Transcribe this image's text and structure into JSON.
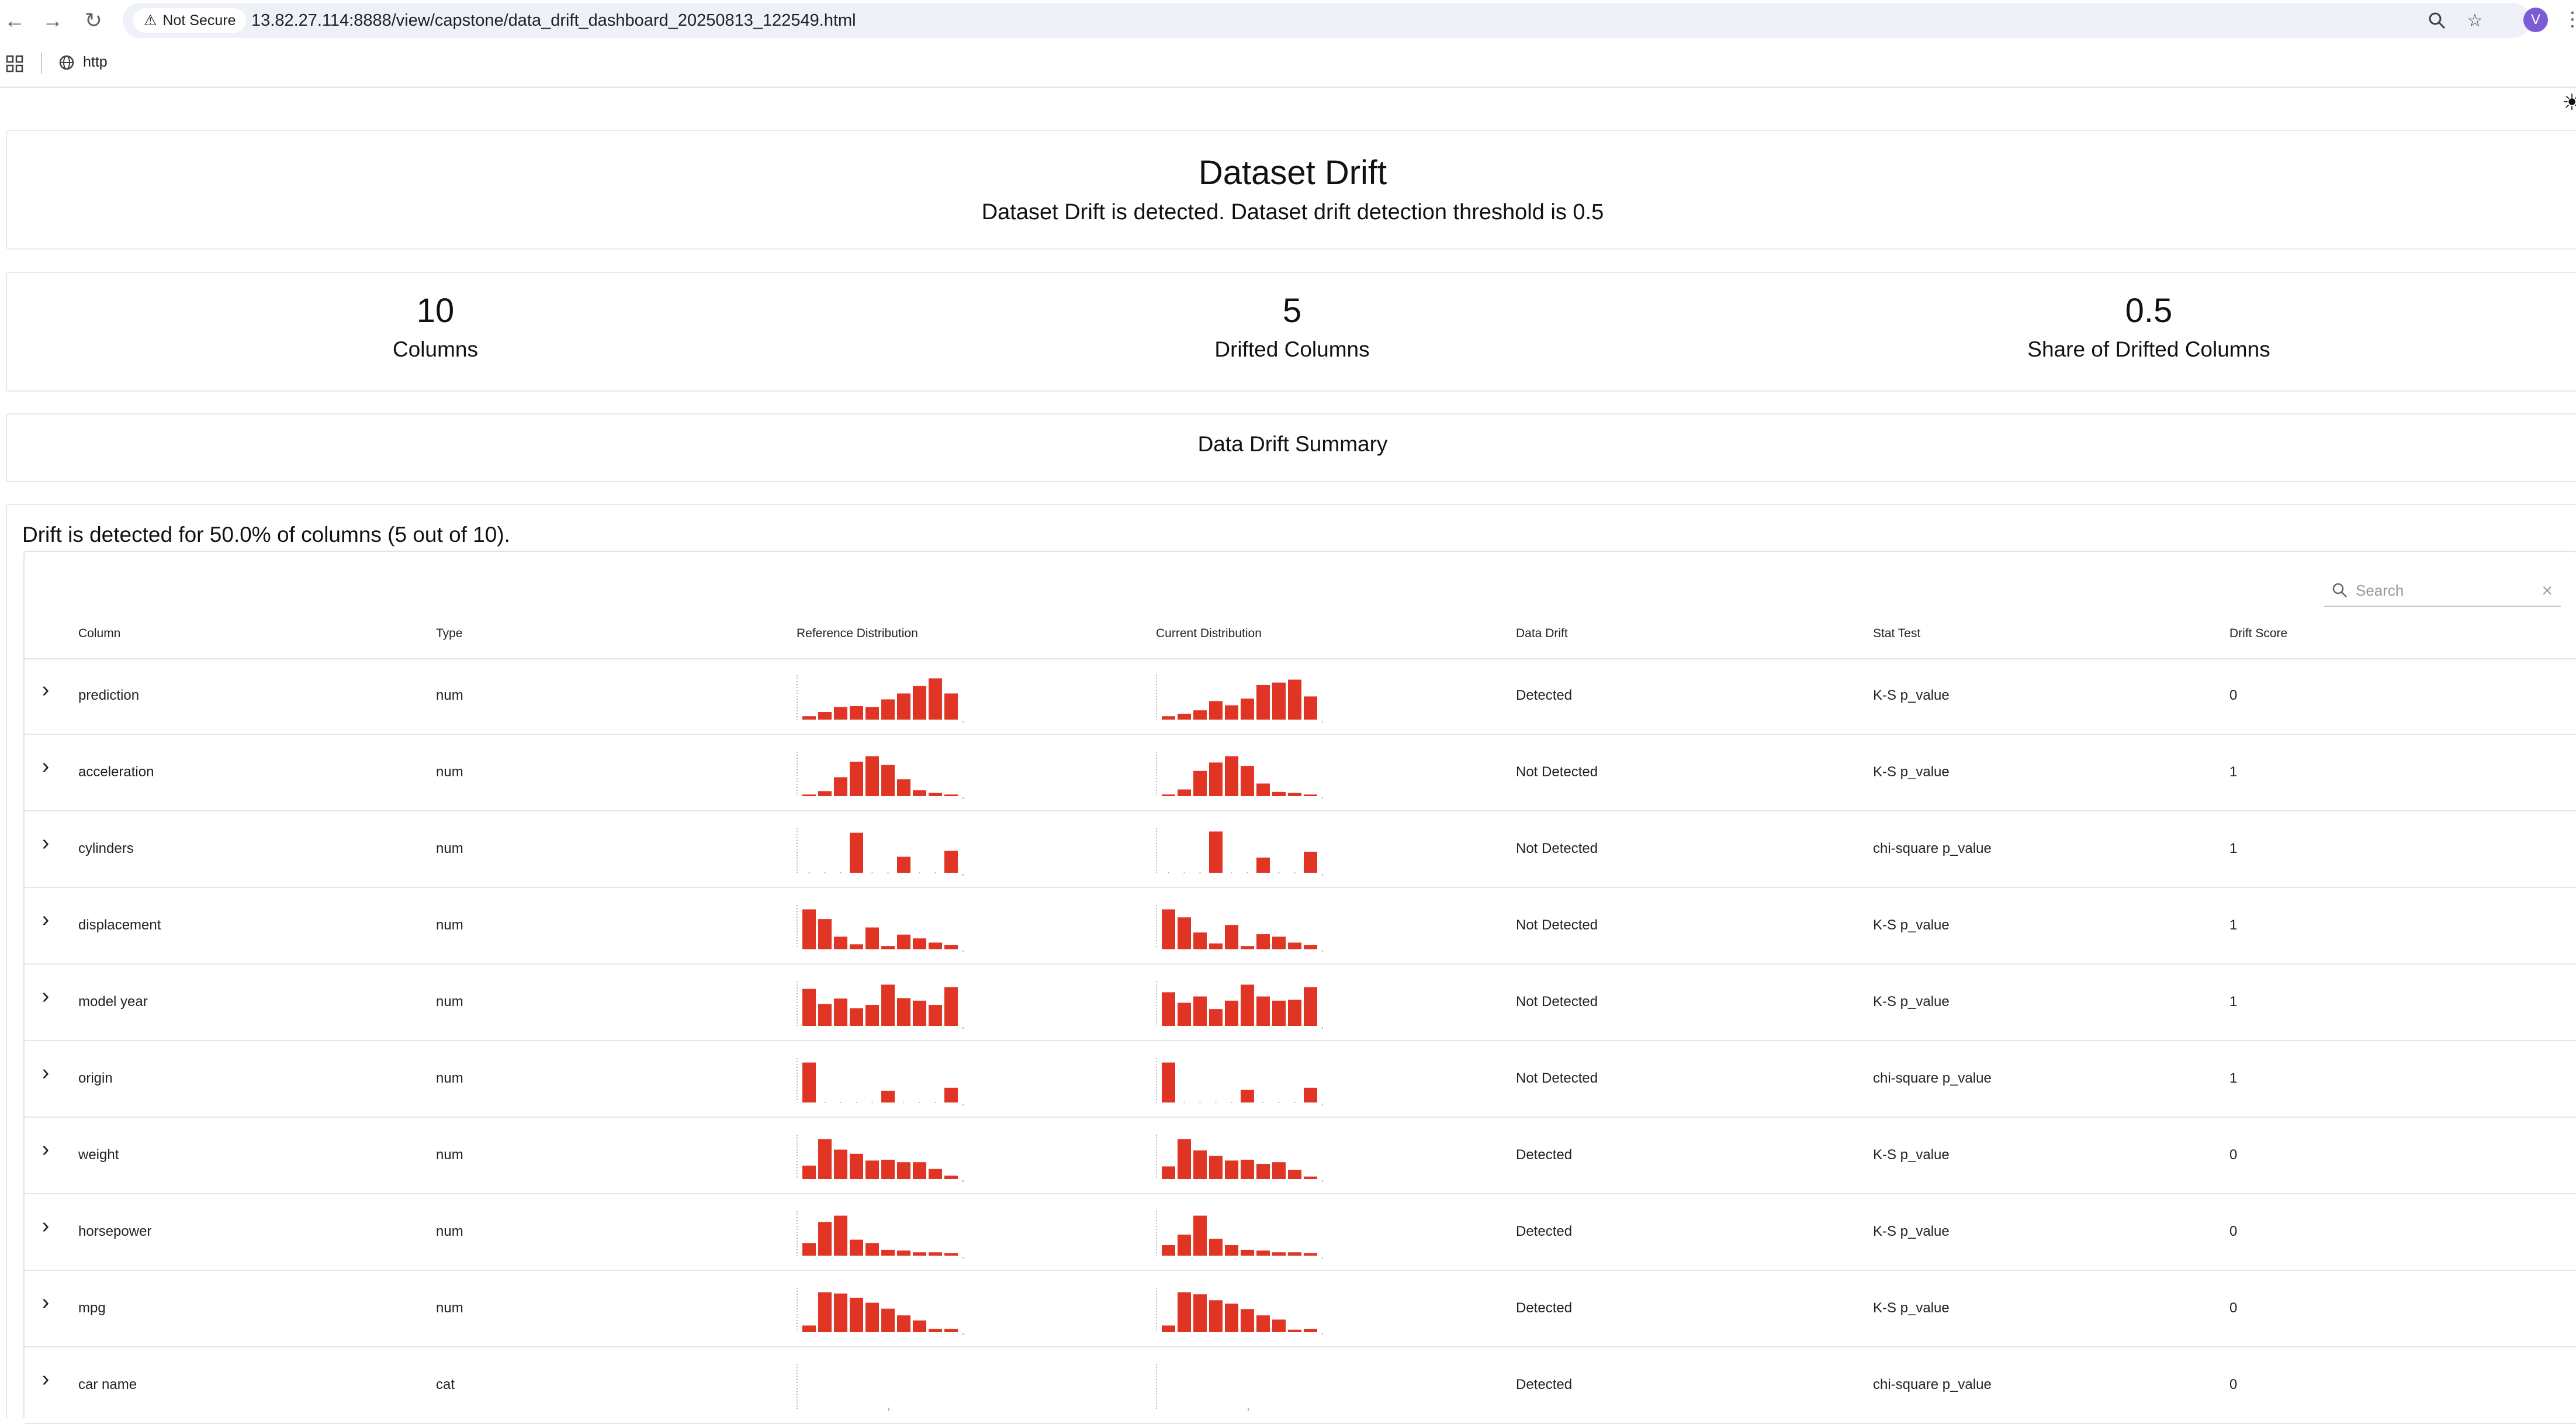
{
  "browser": {
    "security_label": "Not Secure",
    "url": "13.82.27.114:8888/view/capstone/data_drift_dashboard_20250813_122549.html",
    "avatar_letter": "V",
    "bookmark_label": "http"
  },
  "header": {
    "title": "Dataset Drift",
    "subtitle": "Dataset Drift is detected. Dataset drift detection threshold is 0.5"
  },
  "counters": [
    {
      "value": "10",
      "label": "Columns"
    },
    {
      "value": "5",
      "label": "Drifted Columns"
    },
    {
      "value": "0.5",
      "label": "Share of Drifted Columns"
    }
  ],
  "summary": {
    "title": "Data Drift Summary",
    "drift_text": "Drift is detected for 50.0% of columns (5 out of 10)."
  },
  "table": {
    "search_placeholder": "Search",
    "columns": [
      "Column",
      "Type",
      "Reference Distribution",
      "Current Distribution",
      "Data Drift",
      "Stat Test",
      "Drift Score"
    ],
    "rows": [
      {
        "column": "prediction",
        "type": "num",
        "drift": "Detected",
        "test": "K-S p_value",
        "score": "0",
        "ref": [
          0.08,
          0.18,
          0.3,
          0.32,
          0.3,
          0.48,
          0.62,
          0.8,
          0.98,
          0.62
        ],
        "cur": [
          0.08,
          0.14,
          0.22,
          0.44,
          0.34,
          0.5,
          0.82,
          0.88,
          0.95,
          0.55
        ]
      },
      {
        "column": "acceleration",
        "type": "num",
        "drift": "Not Detected",
        "test": "K-S p_value",
        "score": "1",
        "ref": [
          0.04,
          0.12,
          0.45,
          0.82,
          0.95,
          0.74,
          0.4,
          0.14,
          0.08,
          0.04
        ],
        "cur": [
          0.04,
          0.16,
          0.6,
          0.8,
          0.95,
          0.72,
          0.3,
          0.1,
          0.08,
          0.04
        ]
      },
      {
        "column": "cylinders",
        "type": "num",
        "drift": "Not Detected",
        "test": "chi-square p_value",
        "score": "1",
        "ref": [
          0,
          0,
          0,
          0.95,
          0,
          0,
          0.38,
          0,
          0,
          0.52
        ],
        "cur": [
          0,
          0,
          0,
          0.98,
          0,
          0,
          0.36,
          0,
          0,
          0.5
        ]
      },
      {
        "column": "displacement",
        "type": "num",
        "drift": "Not Detected",
        "test": "K-S p_value",
        "score": "1",
        "ref": [
          0.95,
          0.72,
          0.3,
          0.12,
          0.52,
          0.08,
          0.35,
          0.26,
          0.16,
          0.1
        ],
        "cur": [
          0.95,
          0.76,
          0.4,
          0.14,
          0.58,
          0.08,
          0.36,
          0.3,
          0.16,
          0.1
        ]
      },
      {
        "column": "model year",
        "type": "num",
        "drift": "Not Detected",
        "test": "K-S p_value",
        "score": "1",
        "ref": [
          0.88,
          0.52,
          0.65,
          0.42,
          0.5,
          0.98,
          0.66,
          0.6,
          0.5,
          0.92
        ],
        "cur": [
          0.8,
          0.55,
          0.7,
          0.4,
          0.6,
          0.98,
          0.7,
          0.6,
          0.62,
          0.92
        ]
      },
      {
        "column": "origin",
        "type": "num",
        "drift": "Not Detected",
        "test": "chi-square p_value",
        "score": "1",
        "ref": [
          0.95,
          0,
          0,
          0,
          0,
          0.28,
          0,
          0,
          0,
          0.35
        ],
        "cur": [
          0.95,
          0,
          0,
          0,
          0,
          0.3,
          0,
          0,
          0,
          0.35
        ]
      },
      {
        "column": "weight",
        "type": "num",
        "drift": "Detected",
        "test": "K-S p_value",
        "score": "0",
        "ref": [
          0.32,
          0.95,
          0.7,
          0.6,
          0.44,
          0.46,
          0.4,
          0.4,
          0.24,
          0.08
        ],
        "cur": [
          0.3,
          0.95,
          0.68,
          0.55,
          0.44,
          0.46,
          0.36,
          0.4,
          0.22,
          0.06
        ]
      },
      {
        "column": "horsepower",
        "type": "num",
        "drift": "Detected",
        "test": "K-S p_value",
        "score": "0",
        "ref": [
          0.3,
          0.8,
          0.95,
          0.38,
          0.3,
          0.14,
          0.12,
          0.08,
          0.08,
          0.06
        ],
        "cur": [
          0.25,
          0.5,
          0.95,
          0.4,
          0.25,
          0.14,
          0.12,
          0.08,
          0.08,
          0.06
        ]
      },
      {
        "column": "mpg",
        "type": "num",
        "drift": "Detected",
        "test": "K-S p_value",
        "score": "0",
        "ref": [
          0.16,
          0.95,
          0.92,
          0.82,
          0.7,
          0.56,
          0.4,
          0.28,
          0.08,
          0.08
        ],
        "cur": [
          0.16,
          0.95,
          0.9,
          0.76,
          0.68,
          0.55,
          0.4,
          0.3,
          0.06,
          0.08
        ]
      },
      {
        "column": "car name",
        "type": "cat",
        "drift": "Detected",
        "test": "chi-square p_value",
        "score": "0",
        "ref": [],
        "cur": []
      }
    ]
  },
  "colors": {
    "bar": "#e03424",
    "axis": "#b8b8b8",
    "border": "#e6e6e6"
  }
}
